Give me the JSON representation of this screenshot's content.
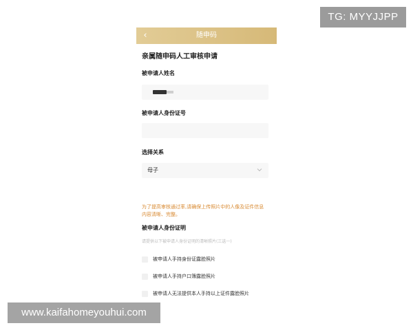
{
  "nav": {
    "back_icon": "chevron-left-icon",
    "title": "随申码"
  },
  "form": {
    "title": "亲属随申码人工审核申请",
    "name_label": "被申请人姓名",
    "id_label": "被申请人身份证号",
    "relation_label": "选择关系",
    "relation_value": "母子",
    "relation_icon": "chevron-down-icon",
    "warning": "为了提高审核通过率,请确保上传照片中的人像及证件信息内容清晰、完整。",
    "proof_label": "被申请人身份证明",
    "proof_hint": "请提供以下被申请人身份证明的清晰照片(三选一)",
    "options": [
      "被申请人手持身份证露脸照片",
      "被申请人手持户口簿露脸照片",
      "被申请人无法提供本人手持以上证件露脸照片"
    ]
  },
  "watermarks": {
    "top": "TG: MYYJJPP",
    "bottom": "www.kaifahomeyouhui.com"
  },
  "colors": {
    "nav_gradient_start": "#e2cc96",
    "nav_gradient_end": "#d6b978",
    "warning": "#d88a32"
  }
}
